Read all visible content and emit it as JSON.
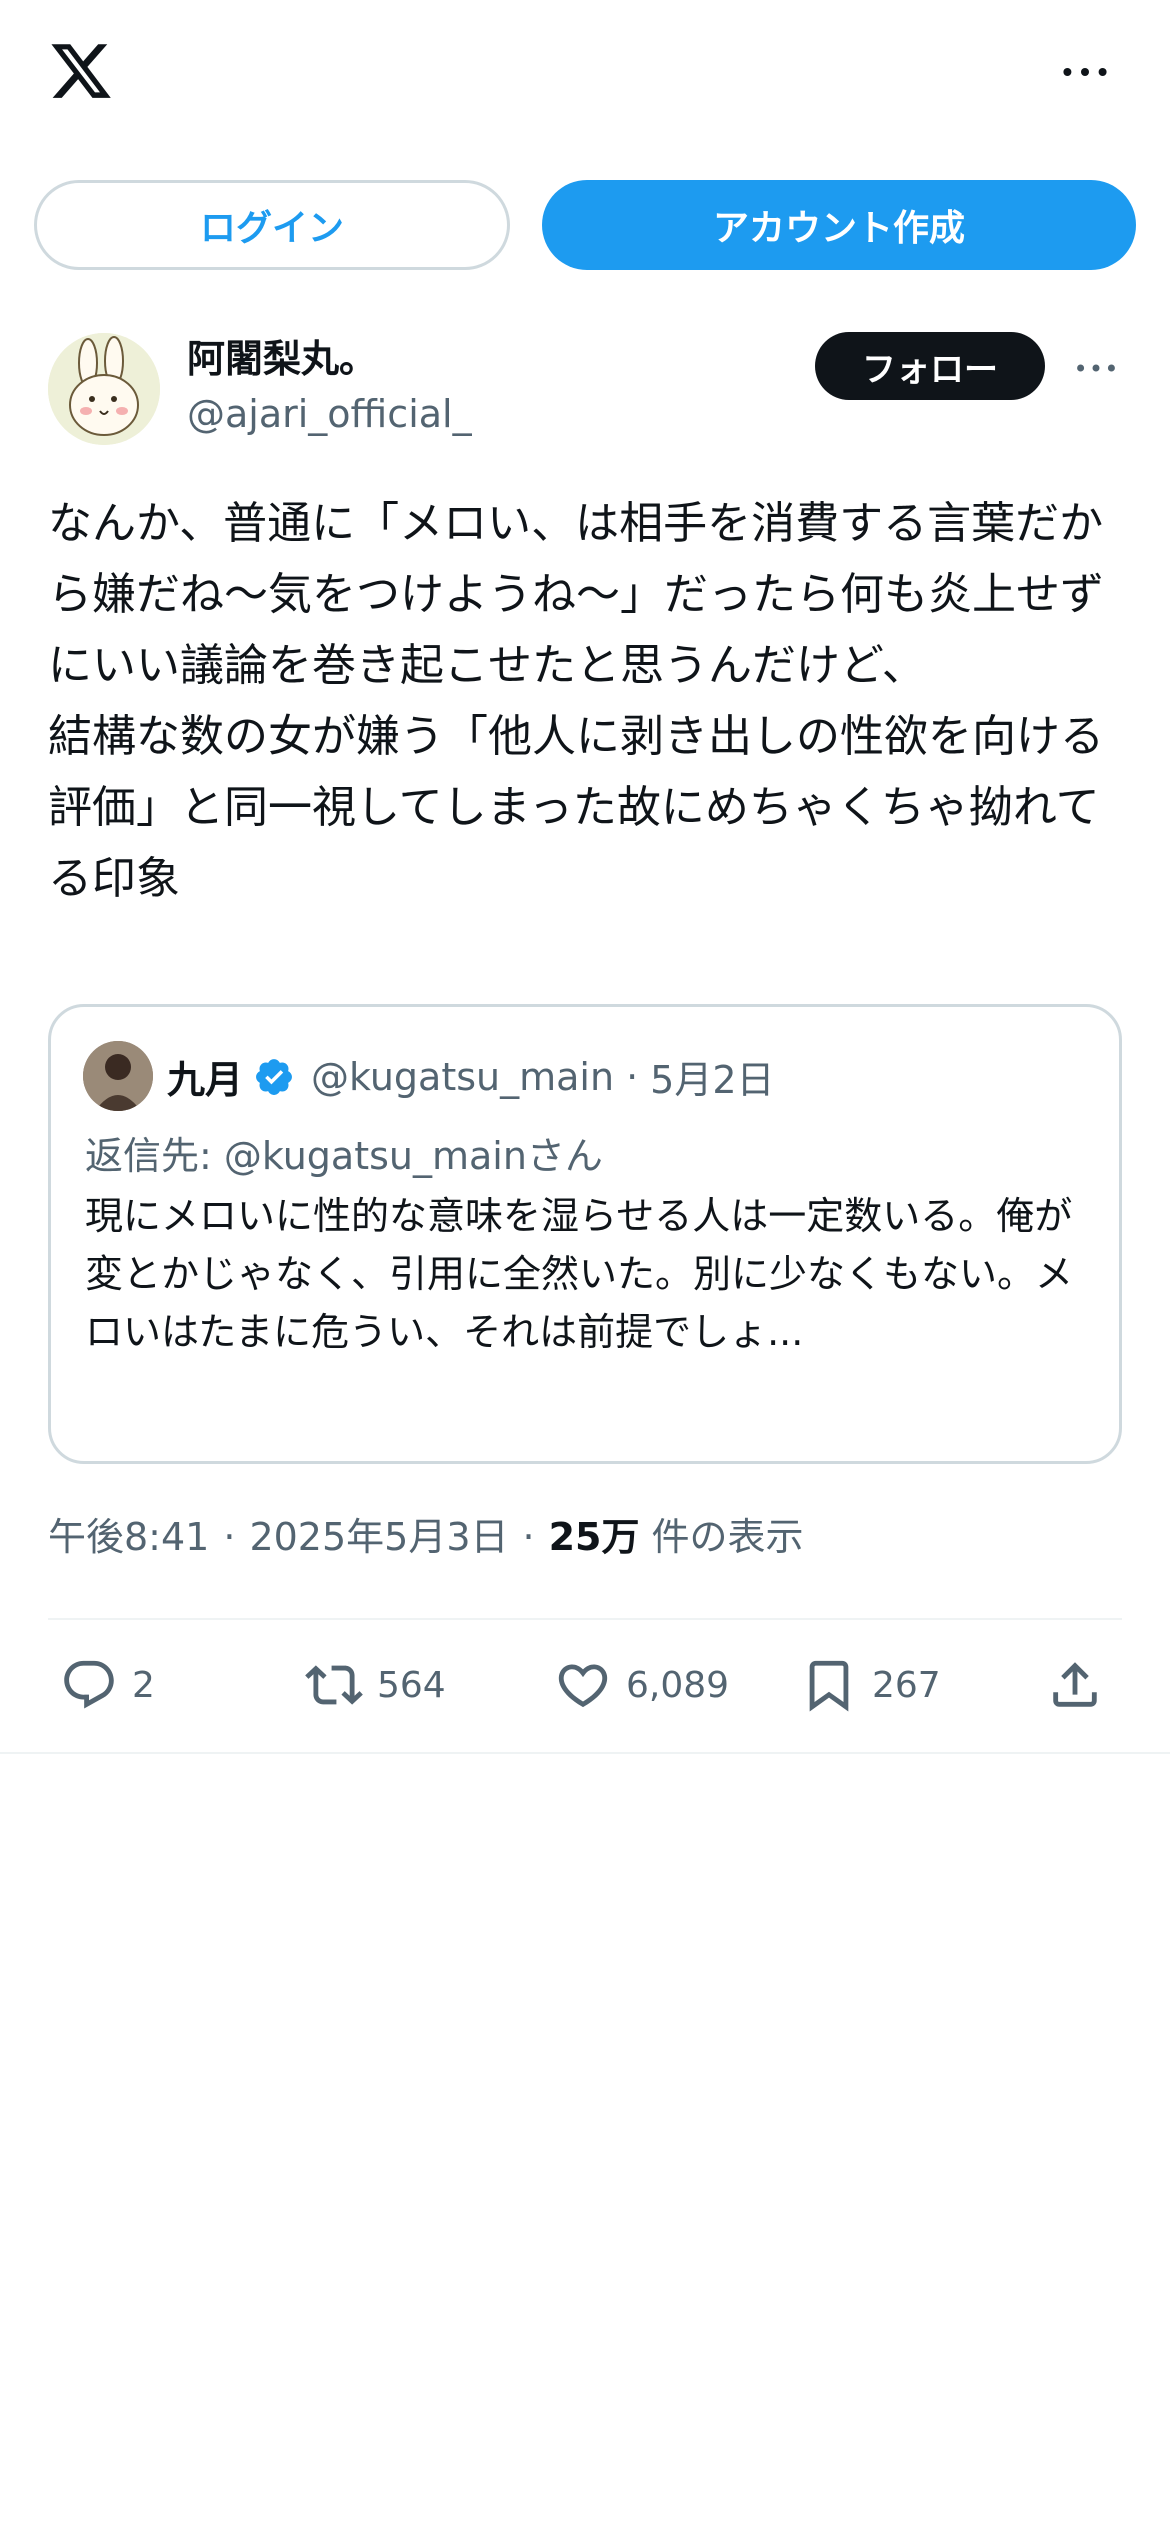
{
  "header": {
    "logo_icon": "x-logo-icon",
    "more_icon": "more-horizontal-icon"
  },
  "auth": {
    "login_label": "ログイン",
    "signup_label": "アカウント作成",
    "accent_color": "#1d9bf0"
  },
  "post": {
    "author_name": "阿闍梨丸。",
    "author_handle": "@ajari_official_",
    "follow_label": "フォロー",
    "text": "なんか、普通に「メロい、は相手を消費する言葉だから嫌だね〜気をつけようね〜」だったら何も炎上せずにいい議論を巻き起こせたと思うんだけど、\n結構な数の女が嫌う「他人に剥き出しの性欲を向ける評価」と同一視してしまった故にめちゃくちゃ拗れてる印象",
    "quote": {
      "name": "九月",
      "verified": true,
      "handle": "@kugatsu_main",
      "separator": "·",
      "date": "5月2日",
      "reply_to": "返信先: @kugatsu_mainさん",
      "text": "現にメロいに性的な意味を湿らせる人は一定数いる。俺が変とかじゃなく、引用に全然いた。別に少なくもない。メロいはたまに危うい、それは前提でしょ..."
    },
    "meta": {
      "time": "午後8:41",
      "separator": "·",
      "date": "2025年5月3日",
      "views_count": "25万",
      "views_label": "件の表示"
    },
    "actions": {
      "replies": "2",
      "reposts": "564",
      "likes": "6,089",
      "bookmarks": "267"
    }
  }
}
